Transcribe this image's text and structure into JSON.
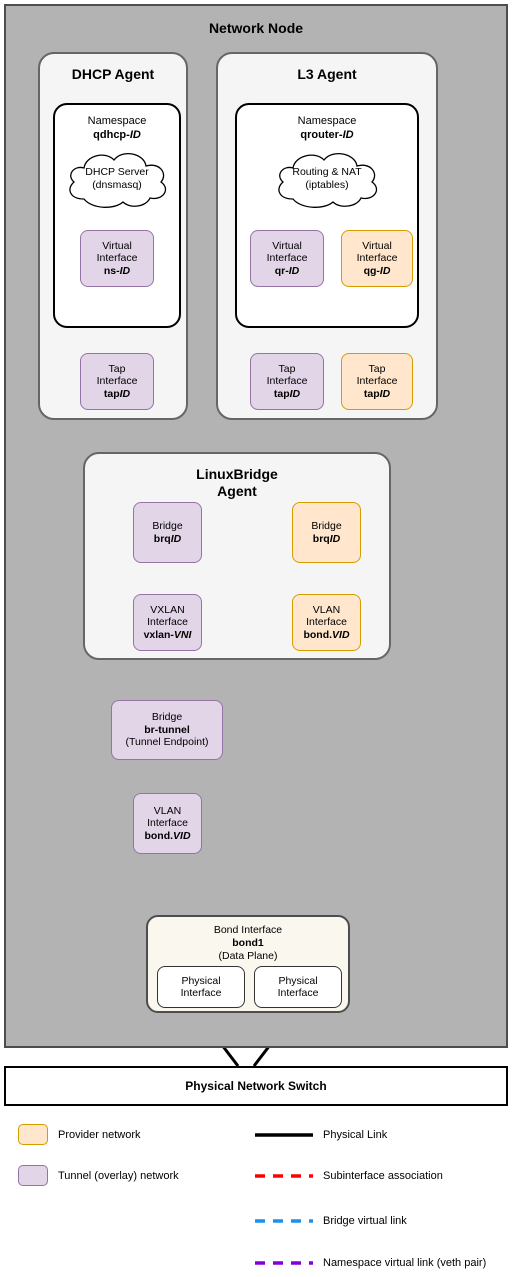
{
  "diagram": {
    "title": "Network Node",
    "switch_label": "Physical Network Switch"
  },
  "agents": {
    "dhcp": {
      "title": "DHCP Agent",
      "namespace": {
        "label": "Namespace",
        "name": "qdhcp-",
        "id": "ID"
      },
      "cloud": {
        "line1": "DHCP Server",
        "line2": "(dnsmasq)"
      },
      "virtual_interface": {
        "line1": "Virtual",
        "line2": "Interface",
        "name": "ns-",
        "id": "ID"
      },
      "tap_interface": {
        "line1": "Tap",
        "line2": "Interface",
        "name": "tap",
        "id": "ID"
      }
    },
    "l3": {
      "title": "L3 Agent",
      "namespace": {
        "label": "Namespace",
        "name": "qrouter-",
        "id": "ID"
      },
      "cloud": {
        "line1": "Routing & NAT",
        "line2": "(iptables)"
      },
      "virtual_interface_qr": {
        "line1": "Virtual",
        "line2": "Interface",
        "name": "qr-",
        "id": "ID"
      },
      "virtual_interface_qg": {
        "line1": "Virtual",
        "line2": "Interface",
        "name": "qg-",
        "id": "ID"
      },
      "tap_interface_qr": {
        "line1": "Tap",
        "line2": "Interface",
        "name": "tap",
        "id": "ID"
      },
      "tap_interface_qg": {
        "line1": "Tap",
        "line2": "Interface",
        "name": "tap",
        "id": "ID"
      }
    },
    "linuxbridge": {
      "title_line1": "LinuxBridge",
      "title_line2": "Agent",
      "bridge_tunnel": {
        "line1": "Bridge",
        "name": "brq",
        "id": "ID"
      },
      "bridge_provider": {
        "line1": "Bridge",
        "name": "brq",
        "id": "ID"
      },
      "vxlan_interface": {
        "line1": "VXLAN",
        "line2": "Interface",
        "name": "vxlan-",
        "id": "VNI"
      },
      "vlan_interface": {
        "line1": "VLAN",
        "line2": "Interface",
        "name": "bond.",
        "id": "VID"
      }
    }
  },
  "tunnel": {
    "bridge": {
      "line1": "Bridge",
      "name": "br-tunnel",
      "line3": "(Tunnel Endpoint)"
    },
    "vlan_interface": {
      "line1": "VLAN",
      "line2": "Interface",
      "name": "bond.",
      "id": "VID"
    }
  },
  "bond": {
    "label": "Bond Interface",
    "name": "bond1",
    "sublabel": "(Data Plane)",
    "nic1": {
      "line1": "Physical",
      "line2": "Interface"
    },
    "nic2": {
      "line1": "Physical",
      "line2": "Interface"
    }
  },
  "legend": {
    "provider_network": "Provider network",
    "tunnel_network": "Tunnel (overlay) network",
    "physical_link": "Physical Link",
    "subinterface_association": "Subinterface association",
    "bridge_virtual_link": "Bridge virtual link",
    "namespace_virtual_link": "Namespace virtual link (veth pair)"
  },
  "colors": {
    "provider": "#ffe6cc",
    "provider_border": "#d79b00",
    "tunnel": "#e1d5e7",
    "tunnel_border": "#9673a6",
    "physical_link": "#000000",
    "subinterface": "#ff0000",
    "bridge_link": "#1f8fe8",
    "namespace_link": "#8000d7",
    "node_bg": "#b3b3b3"
  }
}
